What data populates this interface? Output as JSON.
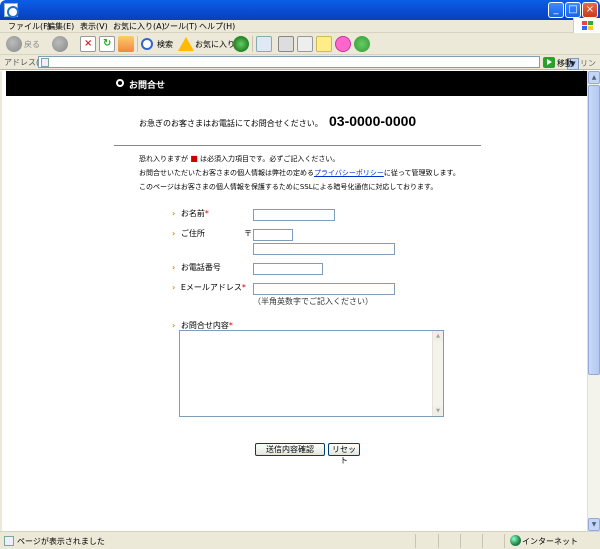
{
  "browser": {
    "menu": [
      "ファイル(F)",
      "編集(E)",
      "表示(V)",
      "お気に入り(A)",
      "ツール(T)",
      "ヘルプ(H)"
    ],
    "toolbar": {
      "back_label": "戻る",
      "search_label": "検索",
      "favorites_label": "お気に入り"
    },
    "address_label": "アドレス(D)",
    "address_value": "",
    "go_label": "移動",
    "links_label": "リンク"
  },
  "page": {
    "header_title": "お問合せ",
    "urgent_text": "お急ぎのお客さまはお電話にてお問合せください。",
    "phone": "03-0000-0000",
    "notice1_before": "恐れ入りますが",
    "notice1_mark": "■",
    "notice1_after": "は必須入力項目です。必ずご記入ください。",
    "notice2_before": "お問合せいただいたお客さまの個人情報は弊社の定める",
    "notice2_link": "プライバシーポリシー",
    "notice2_after": "に従って管理致します。",
    "notice3": "このページはお客さまの個人情報を保護するためにSSLによる暗号化通信に対応しております。",
    "fields": {
      "name_label": "お名前",
      "address_label": "ご住所",
      "zip_mark": "〒",
      "phone_label": "お電話番号",
      "email_label": "Eメールアドレス",
      "email_hint": "（半角英数字でご記入ください）",
      "inquiry_label": "お問合せ内容"
    },
    "required_mark": "*",
    "confirm_button": "送信内容確認",
    "reset_button": "リセット"
  },
  "status": {
    "text": "ページが表示されました",
    "zone": "インターネット"
  }
}
